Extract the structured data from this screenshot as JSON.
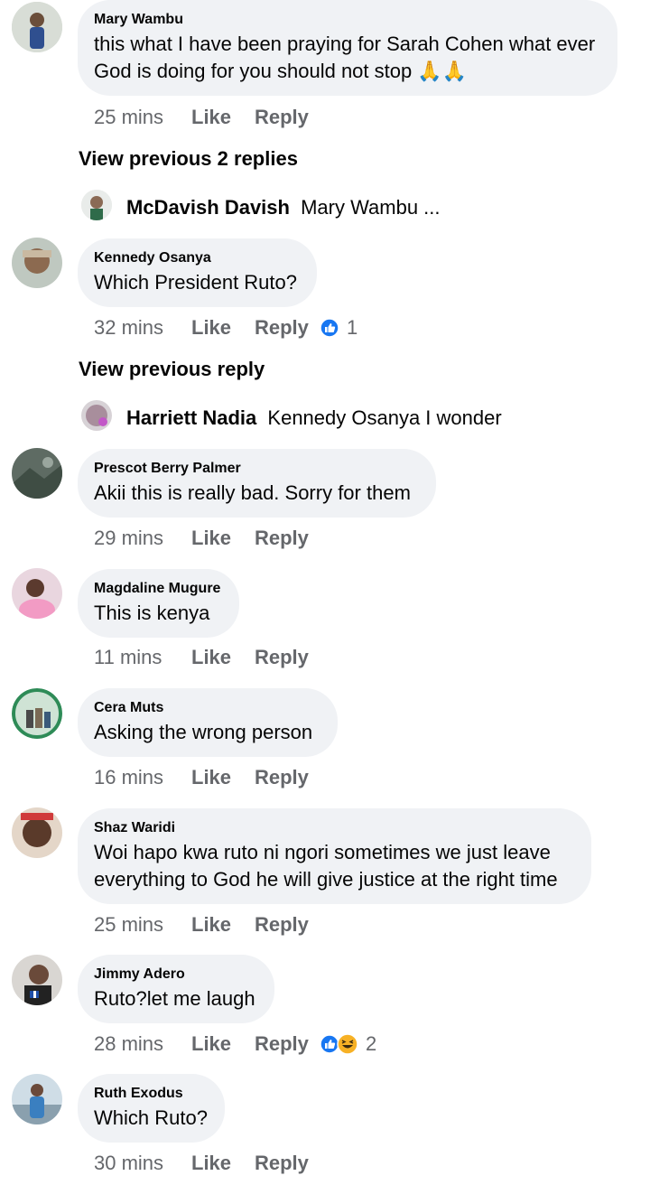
{
  "comments": [
    {
      "author": "Mary Wambu",
      "text_lines": [
        "this what I have been praying for Sarah Cohen what ever",
        "God is doing for you should not stop 🙏🙏"
      ],
      "time": "25 mins",
      "like": "Like",
      "reply": "Reply",
      "avatar_color": "#9fb3a8"
    },
    {
      "author": "Kennedy Osanya",
      "text_lines": [
        "Which President Ruto?"
      ],
      "time": "32 mins",
      "like": "Like",
      "reply": "Reply",
      "reaction_count": "1",
      "avatar_color": "#8c7a66"
    },
    {
      "author": "Prescot Berry Palmer",
      "text_lines": [
        "Akii this is really bad. Sorry for them"
      ],
      "time": "29 mins",
      "like": "Like",
      "reply": "Reply",
      "avatar_color": "#4d5b52"
    },
    {
      "author": "Magdaline Mugure",
      "text_lines": [
        "This is kenya"
      ],
      "time": "11 mins",
      "like": "Like",
      "reply": "Reply",
      "avatar_color": "#e38bb0"
    },
    {
      "author": "Cera Muts",
      "text_lines": [
        "Asking the wrong person"
      ],
      "time": "16 mins",
      "like": "Like",
      "reply": "Reply",
      "avatar_color": "#4f8f5e"
    },
    {
      "author": "Shaz Waridi",
      "text_lines": [
        "Woi hapo kwa ruto ni ngori sometimes we just leave",
        "everything to God  he will give justice at the right time"
      ],
      "time": "25 mins",
      "like": "Like",
      "reply": "Reply",
      "avatar_color": "#6b4a3a"
    },
    {
      "author": "Jimmy Adero",
      "text_lines": [
        "Ruto?let me laugh"
      ],
      "time": "28 mins",
      "like": "Like",
      "reply": "Reply",
      "reaction_count": "2",
      "avatar_color": "#3a3a3a"
    },
    {
      "author": "Ruth Exodus",
      "text_lines": [
        "Which Ruto?"
      ],
      "time": "30 mins",
      "like": "Like",
      "reply": "Reply",
      "avatar_color": "#5a8fb8"
    }
  ],
  "view_previous": [
    {
      "label": "View previous 2 replies"
    },
    {
      "label": "View previous reply"
    }
  ],
  "nested_replies": [
    {
      "author": "McDavish Davish",
      "text": "Mary Wambu ..."
    },
    {
      "author": "Harriett Nadia",
      "text": "Kennedy Osanya I wonder"
    }
  ],
  "colors": {
    "bubble": "#f0f2f5",
    "meta_text": "#65676b",
    "like_blue": "#1877f2",
    "haha_yellow": "#f7b125"
  },
  "icons": {
    "like_reaction": "like-reaction-icon",
    "haha_reaction": "haha-reaction-icon",
    "pray_emoji": "folded-hands-emoji"
  }
}
